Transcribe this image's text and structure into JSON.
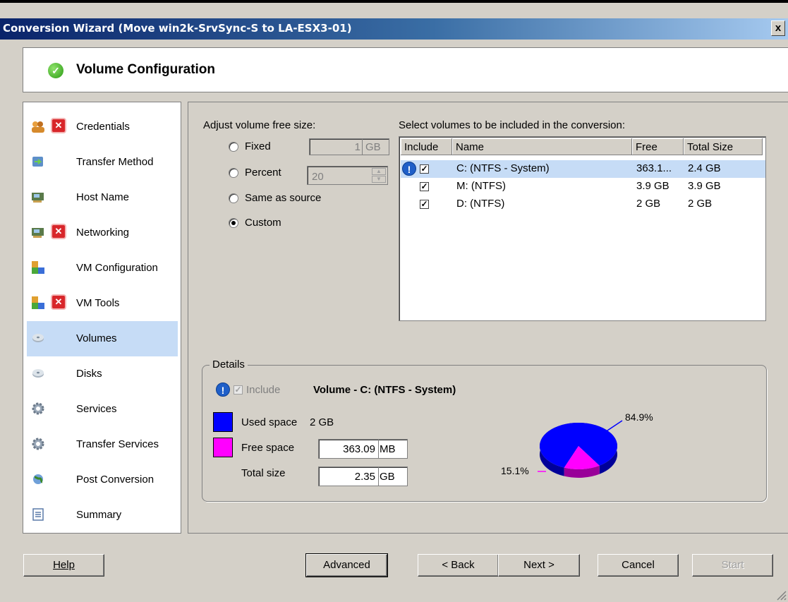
{
  "window": {
    "title": "Conversion Wizard (Move win2k-SrvSync-S to LA-ESX3-01)",
    "close_label": "x"
  },
  "header": {
    "title": "Volume Configuration",
    "status_icon": "check-icon"
  },
  "sidebar": {
    "items": [
      {
        "label": "Credentials",
        "icon": "users-icon",
        "error": true
      },
      {
        "label": "Transfer Method",
        "icon": "transfer-icon",
        "error": false
      },
      {
        "label": "Host Name",
        "icon": "network-card-icon",
        "error": false
      },
      {
        "label": "Networking",
        "icon": "network-card-icon",
        "error": true
      },
      {
        "label": "VM Configuration",
        "icon": "vm-icon",
        "error": false
      },
      {
        "label": "VM Tools",
        "icon": "vm-icon",
        "error": true
      },
      {
        "label": "Volumes",
        "icon": "disk-icon",
        "error": false,
        "selected": true
      },
      {
        "label": "Disks",
        "icon": "disk-icon",
        "error": false
      },
      {
        "label": "Services",
        "icon": "gear-icon",
        "error": false
      },
      {
        "label": "Transfer Services",
        "icon": "gear-icon",
        "error": false
      },
      {
        "label": "Post Conversion",
        "icon": "globe-icon",
        "error": false
      },
      {
        "label": "Summary",
        "icon": "document-icon",
        "error": false
      }
    ]
  },
  "free_size": {
    "label": "Adjust volume free size:",
    "options": [
      {
        "label": "Fixed",
        "checked": false
      },
      {
        "label": "Percent",
        "checked": false
      },
      {
        "label": "Same as source",
        "checked": false
      },
      {
        "label": "Custom",
        "checked": true
      }
    ],
    "fixed_value": "1",
    "fixed_unit": "GB",
    "percent_value": "20"
  },
  "volumes": {
    "label": "Select volumes to be included in the conversion:",
    "columns": [
      "Include",
      "Name",
      "Free",
      "Total Size"
    ],
    "rows": [
      {
        "include": true,
        "warning": true,
        "name": "C: (NTFS - System)",
        "free": "363.1...",
        "total": "2.4 GB",
        "selected": true
      },
      {
        "include": true,
        "warning": false,
        "name": "M: (NTFS)",
        "free": "3.9 GB",
        "total": "3.9 GB",
        "selected": false
      },
      {
        "include": true,
        "warning": false,
        "name": "D: (NTFS)",
        "free": "2 GB",
        "total": "2 GB",
        "selected": false
      }
    ]
  },
  "details": {
    "legend": "Details",
    "include_label": "Include",
    "volume_title": "Volume - C: (NTFS - System)",
    "used_label": "Used space",
    "used_value": "2 GB",
    "free_label": "Free space",
    "free_value": "363.09",
    "free_unit": "MB",
    "total_label": "Total size",
    "total_value": "2.35",
    "total_unit": "GB",
    "used_color": "#0000ff",
    "free_color": "#ff00ff"
  },
  "chart_data": {
    "type": "pie",
    "slices": [
      {
        "label": "84.9%",
        "value": 84.9,
        "color": "#0000ff"
      },
      {
        "label": "15.1%",
        "value": 15.1,
        "color": "#ff00ff"
      }
    ]
  },
  "buttons": {
    "help": "Help",
    "advanced": "Advanced",
    "back": "< Back",
    "next": "Next >",
    "cancel": "Cancel",
    "start": "Start"
  }
}
